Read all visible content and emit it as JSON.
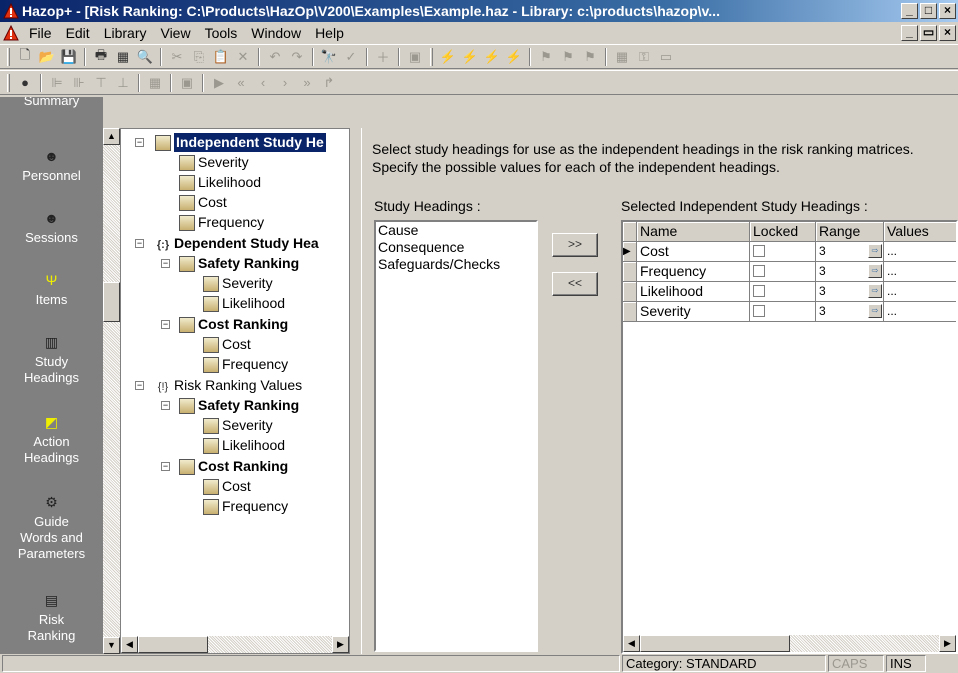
{
  "window": {
    "title": "Hazop+ - [Risk Ranking: C:\\Products\\HazOp\\V200\\Examples\\Example.haz - Library: c:\\products\\hazop\\v...",
    "minimize": "_",
    "maximize": "□",
    "close": "×",
    "mdi_minimize": "_",
    "mdi_restore": "▭",
    "mdi_close": "×"
  },
  "menu": [
    "File",
    "Edit",
    "Library",
    "View",
    "Tools",
    "Window",
    "Help"
  ],
  "nav": {
    "items": [
      {
        "label": "Summary",
        "icon": "summary-icon"
      },
      {
        "label": "Personnel",
        "icon": "personnel-icon"
      },
      {
        "label": "Sessions",
        "icon": "sessions-icon"
      },
      {
        "label": "Items",
        "icon": "items-icon"
      },
      {
        "label": "Study\nHeadings",
        "icon": "study-headings-icon"
      },
      {
        "label": "Action\nHeadings",
        "icon": "action-headings-icon"
      },
      {
        "label": "Guide\nWords and\nParameters",
        "icon": "guide-words-icon"
      },
      {
        "label": "Risk\nRanking",
        "icon": "risk-ranking-icon"
      }
    ]
  },
  "tree": {
    "n0": "Independent Study He",
    "n1": "Severity",
    "n2": "Likelihood",
    "n3": "Cost",
    "n4": "Frequency",
    "n5": "Dependent Study Hea",
    "n6": "Safety Ranking",
    "n7": "Severity",
    "n8": "Likelihood",
    "n9": "Cost Ranking",
    "n10": "Cost",
    "n11": "Frequency",
    "n12": "Risk Ranking Values",
    "n13": "Safety Ranking",
    "n14": "Severity",
    "n15": "Likelihood",
    "n16": "Cost Ranking",
    "n17": "Cost",
    "n18": "Frequency"
  },
  "panel": {
    "instruction_line1": "Select study headings for use as the independent headings in the risk ranking matrices.",
    "instruction_line2": "Specify the possible values for each of the independent headings.",
    "study_headings_label": "Study Headings :",
    "study_headings": [
      "Cause",
      "Consequence",
      "Safeguards/Checks"
    ],
    "add_button": ">>",
    "remove_button": "<<",
    "selected_label": "Selected Independent Study Headings :",
    "columns": [
      "Name",
      "Locked",
      "Range",
      "Values"
    ],
    "rows": [
      {
        "name": "Cost",
        "range": "3",
        "values": "..."
      },
      {
        "name": "Frequency",
        "range": "3",
        "values": "..."
      },
      {
        "name": "Likelihood",
        "range": "3",
        "values": "..."
      },
      {
        "name": "Severity",
        "range": "3",
        "values": "..."
      }
    ]
  },
  "status": {
    "category": "Category: STANDARD",
    "caps": "CAPS",
    "ins": "INS"
  },
  "colors": {
    "titlebar": "#0a246a",
    "selection": "#0a246a",
    "nav_bg": "#808080",
    "face": "#d4d0c8"
  }
}
